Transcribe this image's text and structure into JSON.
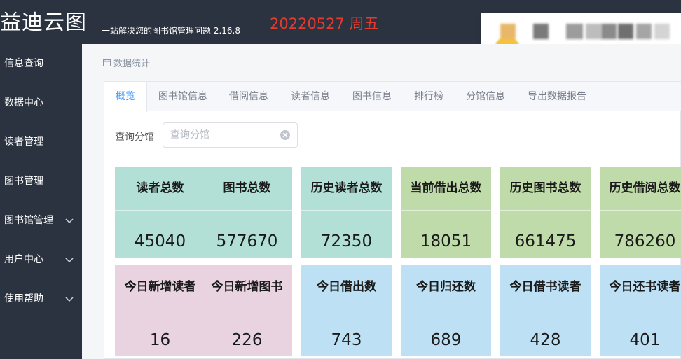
{
  "header": {
    "app_name": "益迪云图",
    "subtitle": "一站解决您的图书馆管理问题 2.16.8",
    "date_stamp": "20220527 周五"
  },
  "sidebar": {
    "items": [
      {
        "label": "信息查询",
        "icon": "none"
      },
      {
        "label": "数据中心",
        "icon": "none"
      },
      {
        "label": "读者管理",
        "icon": "none"
      },
      {
        "label": "图书管理",
        "icon": "none"
      },
      {
        "label": "图书馆管理",
        "icon": "chevron-down-icon"
      },
      {
        "label": "用户中心",
        "icon": "chevron-down-icon"
      },
      {
        "label": "使用帮助",
        "icon": "chevron-down-icon"
      }
    ]
  },
  "breadcrumb": {
    "label": "数据统计",
    "icon": "calendar-icon"
  },
  "tabs": [
    {
      "label": "概览",
      "active": true
    },
    {
      "label": "图书馆信息",
      "active": false
    },
    {
      "label": "借阅信息",
      "active": false
    },
    {
      "label": "读者信息",
      "active": false
    },
    {
      "label": "图书信息",
      "active": false
    },
    {
      "label": "排行榜",
      "active": false
    },
    {
      "label": "分馆信息",
      "active": false
    },
    {
      "label": "导出数据报告",
      "active": false
    }
  ],
  "filter": {
    "label": "查询分馆",
    "placeholder": "查询分馆",
    "value": ""
  },
  "cards": [
    {
      "title": "读者总数",
      "value": "45040",
      "color": "#b2dfd6"
    },
    {
      "title": "图书总数",
      "value": "577670",
      "color": "#b2dfd6"
    },
    {
      "title": "历史读者总数",
      "value": "72350",
      "color": "#b2dfd6"
    },
    {
      "title": "当前借出总数",
      "value": "18051",
      "color": "#bfdba9"
    },
    {
      "title": "历史图书总数",
      "value": "661475",
      "color": "#bfdba9"
    },
    {
      "title": "历史借阅总数",
      "value": "786260",
      "color": "#bfdba9"
    },
    {
      "title": "今日新增读者",
      "value": "16",
      "color": "#e9d3e0"
    },
    {
      "title": "今日新增图书",
      "value": "226",
      "color": "#e9d3e0"
    },
    {
      "title": "今日借出数",
      "value": "743",
      "color": "#bde0f5"
    },
    {
      "title": "今日归还数",
      "value": "689",
      "color": "#bde0f5"
    },
    {
      "title": "今日借书读者",
      "value": "428",
      "color": "#bde0f5"
    },
    {
      "title": "今日还书读者",
      "value": "401",
      "color": "#bde0f5"
    }
  ],
  "colors": {
    "header_bg": "#2b3340",
    "accent": "#409eff",
    "date_red": "#e63a2e"
  }
}
